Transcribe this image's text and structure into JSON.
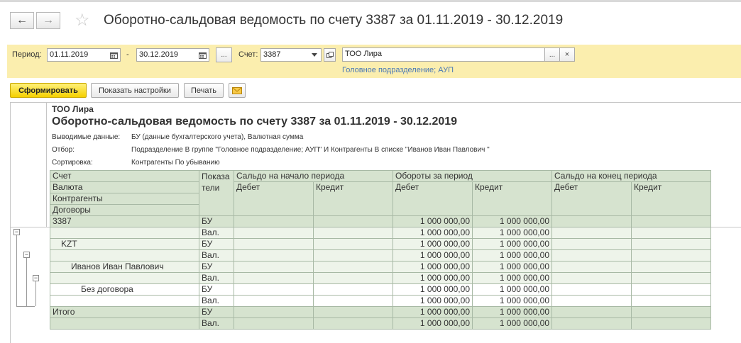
{
  "window": {
    "title": "Оборотно-сальдовая ведомость по счету 3387  за 01.11.2019 - 30.12.2019",
    "back_icon": "←",
    "forward_icon": "→",
    "star_icon": "☆"
  },
  "filters": {
    "period_label": "Период:",
    "date_from": "01.11.2019",
    "dash": "-",
    "date_to": "30.12.2019",
    "ellipsis": "...",
    "account_label": "Счет:",
    "account": "3387",
    "org": "ТОО Лира",
    "subdivision_link": "Головное подразделение; АУП"
  },
  "toolbar": {
    "generate": "Сформировать",
    "settings": "Показать настройки",
    "print": "Печать"
  },
  "report": {
    "org": "ТОО Лира",
    "title": "Оборотно-сальдовая ведомость по счету 3387  за 01.11.2019 - 30.12.2019",
    "output_label": "Выводимые данные:",
    "output_value": "БУ (данные бухгалтерского учета), Валютная сумма",
    "filter_label": "Отбор:",
    "filter_value": "Подразделение В группе \"Головное подразделение; АУП\" И Контрагенты В списке \"Иванов Иван Павлович \"",
    "sort_label": "Сортировка:",
    "sort_value": "Контрагенты По убыванию",
    "headers": {
      "account": "Счет",
      "currency": "Валюта",
      "counterparties": "Контрагенты",
      "contracts": "Договоры",
      "indicators_1": "Показа",
      "indicators_2": "тели",
      "opening": "Сальдо на начало периода",
      "turnover": "Обороты за период",
      "closing": "Сальдо на конец периода",
      "debit": "Дебет",
      "credit": "Кредит"
    },
    "rows": [
      {
        "name": "3387",
        "ind": "БУ",
        "od": "",
        "oc": "",
        "td": "1 000 000,00",
        "tc": "1 000 000,00",
        "cd": "",
        "cc": ""
      },
      {
        "name": "",
        "ind": "Вал.",
        "od": "",
        "oc": "",
        "td": "1 000 000,00",
        "tc": "1 000 000,00",
        "cd": "",
        "cc": ""
      },
      {
        "name": "KZT",
        "ind": "БУ",
        "od": "",
        "oc": "",
        "td": "1 000 000,00",
        "tc": "1 000 000,00",
        "cd": "",
        "cc": ""
      },
      {
        "name": "",
        "ind": "Вал.",
        "od": "",
        "oc": "",
        "td": "1 000 000,00",
        "tc": "1 000 000,00",
        "cd": "",
        "cc": ""
      },
      {
        "name": "Иванов Иван Павлович",
        "ind": "БУ",
        "od": "",
        "oc": "",
        "td": "1 000 000,00",
        "tc": "1 000 000,00",
        "cd": "",
        "cc": ""
      },
      {
        "name": "",
        "ind": "Вал.",
        "od": "",
        "oc": "",
        "td": "1 000 000,00",
        "tc": "1 000 000,00",
        "cd": "",
        "cc": ""
      },
      {
        "name": "Без договора",
        "ind": "БУ",
        "od": "",
        "oc": "",
        "td": "1 000 000,00",
        "tc": "1 000 000,00",
        "cd": "",
        "cc": ""
      },
      {
        "name": "",
        "ind": "Вал.",
        "od": "",
        "oc": "",
        "td": "1 000 000,00",
        "tc": "1 000 000,00",
        "cd": "",
        "cc": ""
      },
      {
        "name": "Итого",
        "ind": "БУ",
        "od": "",
        "oc": "",
        "td": "1 000 000,00",
        "tc": "1 000 000,00",
        "cd": "",
        "cc": ""
      },
      {
        "name": "",
        "ind": "Вал.",
        "od": "",
        "oc": "",
        "td": "1 000 000,00",
        "tc": "1 000 000,00",
        "cd": "",
        "cc": ""
      }
    ]
  },
  "icons": {
    "calendar": "calendar-icon",
    "dropdown": "chevron-down-icon",
    "open": "open-icon",
    "clear": "close-icon",
    "mail": "envelope-icon",
    "collapse": "minus-icon"
  }
}
